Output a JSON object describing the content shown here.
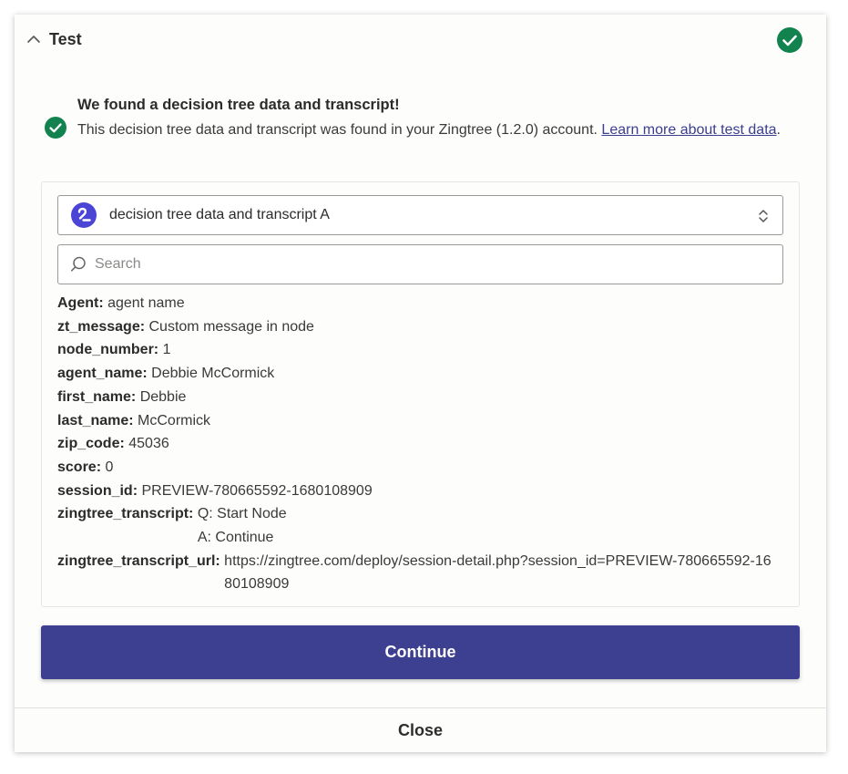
{
  "section": {
    "title": "Test"
  },
  "found": {
    "title": "We found a decision tree data and transcript!",
    "desc_prefix": "This decision tree data and transcript was found in your Zingtree (1.2.0) account. ",
    "link": "Learn more about test data",
    "desc_suffix": "."
  },
  "select": {
    "value": "decision tree data and transcript A"
  },
  "search": {
    "placeholder": "Search"
  },
  "fields": [
    {
      "key": "Agent:",
      "value": "agent name"
    },
    {
      "key": "zt_message:",
      "value": "Custom message in node"
    },
    {
      "key": "node_number:",
      "value": "1"
    },
    {
      "key": "agent_name:",
      "value": "Debbie McCormick"
    },
    {
      "key": "first_name:",
      "value": "Debbie"
    },
    {
      "key": "last_name:",
      "value": "McCormick"
    },
    {
      "key": "zip_code:",
      "value": "45036"
    },
    {
      "key": "score:",
      "value": "0"
    },
    {
      "key": "session_id:",
      "value": "PREVIEW-780665592-1680108909"
    },
    {
      "key": "zingtree_transcript:",
      "value": "Q: Start Node\nA: Continue"
    },
    {
      "key": "zingtree_transcript_url:",
      "value": "https://zingtree.com/deploy/session-detail.php?session_id=PREVIEW-780665592-1680108909"
    }
  ],
  "buttons": {
    "continue": "Continue",
    "close": "Close"
  },
  "icons": {
    "collapse": "chevron-up-icon",
    "status": "check-circle-icon",
    "app": "zingtree-logo-icon",
    "sort": "up-down-chevron-icon",
    "search": "search-icon"
  },
  "colors": {
    "success": "#12834f",
    "primary": "#3d4091",
    "link": "#3b3e8f",
    "app_logo": "#4b45d6"
  }
}
